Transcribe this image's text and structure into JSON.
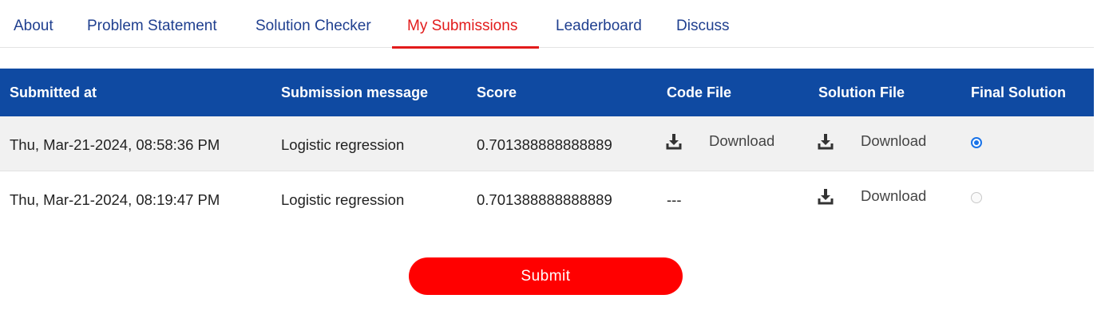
{
  "tabs": [
    {
      "label": "About"
    },
    {
      "label": "Problem Statement"
    },
    {
      "label": "Solution Checker"
    },
    {
      "label": "My Submissions"
    },
    {
      "label": "Leaderboard"
    },
    {
      "label": "Discuss"
    }
  ],
  "active_tab": "My Submissions",
  "table": {
    "headers": [
      "Submitted at",
      "Submission message",
      "Score",
      "Code File",
      "Solution File",
      "Final Solution"
    ],
    "rows": [
      {
        "submitted_at": "Thu, Mar-21-2024, 08:58:36 PM",
        "message": "Logistic regression",
        "score": "0.701388888888889",
        "code_file": "Download",
        "solution_file": "Download",
        "final": true
      },
      {
        "submitted_at": "Thu, Mar-21-2024, 08:19:47 PM",
        "message": "Logistic regression",
        "score": "0.701388888888889",
        "code_file": "---",
        "solution_file": "Download",
        "final": false
      }
    ]
  },
  "submit_label": "Submit",
  "colors": {
    "accent": "#e21b1b",
    "header_bg": "#0f4aa2",
    "tab_text": "#1f3f8f",
    "button_bg": "#ff0000"
  },
  "icons": {
    "download": "download-icon"
  }
}
